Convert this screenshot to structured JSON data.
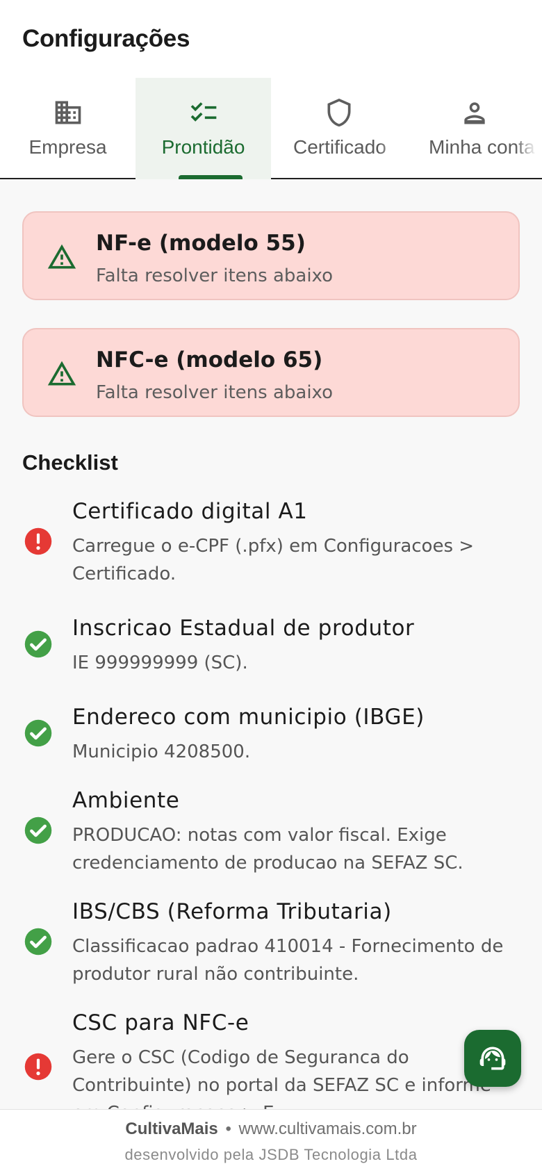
{
  "header": {
    "title": "Configurações",
    "tabs": [
      {
        "label": "Empresa",
        "icon": "building-icon"
      },
      {
        "label": "Prontidão",
        "icon": "checklist-icon",
        "active": true
      },
      {
        "label": "Certificado",
        "icon": "shield-icon"
      },
      {
        "label": "Minha conta",
        "icon": "person-icon"
      }
    ]
  },
  "alerts": [
    {
      "title": "NF-e (modelo 55)",
      "subtitle": "Falta resolver itens abaixo"
    },
    {
      "title": "NFC-e (modelo 65)",
      "subtitle": "Falta resolver itens abaixo"
    }
  ],
  "checklist": {
    "title": "Checklist",
    "items": [
      {
        "title": "Certificado digital A1",
        "description": "Carregue o e-CPF (.pfx) em Configuracoes > Certificado.",
        "status": "error"
      },
      {
        "title": "Inscricao Estadual de produtor",
        "description": "IE 999999999 (SC).",
        "status": "ok"
      },
      {
        "title": "Endereco com municipio (IBGE)",
        "description": "Municipio 4208500.",
        "status": "ok"
      },
      {
        "title": "Ambiente",
        "description": "PRODUCAO: notas com valor fiscal. Exige credenciamento de producao na SEFAZ SC.",
        "status": "ok"
      },
      {
        "title": "IBS/CBS (Reforma Tributaria)",
        "description": "Classificacao padrao 410014 - Fornecimento de produtor rural não contribuinte.",
        "status": "ok"
      },
      {
        "title": "CSC para NFC-e",
        "description": "Gere o CSC (Codigo de Seguranca do Contribuinte) no portal da SEFAZ SC e informe em Configuracoes > E",
        "status": "error"
      }
    ]
  },
  "footer": {
    "brand": "CultivaMais",
    "separator": "•",
    "url": "www.cultivamais.com.br",
    "credit": "desenvolvido pela JSDB Tecnologia Ltda"
  },
  "colors": {
    "accent": "#1b6b30",
    "alert_bg": "#fdd9d6",
    "ok": "#43a047",
    "error": "#e53935"
  }
}
